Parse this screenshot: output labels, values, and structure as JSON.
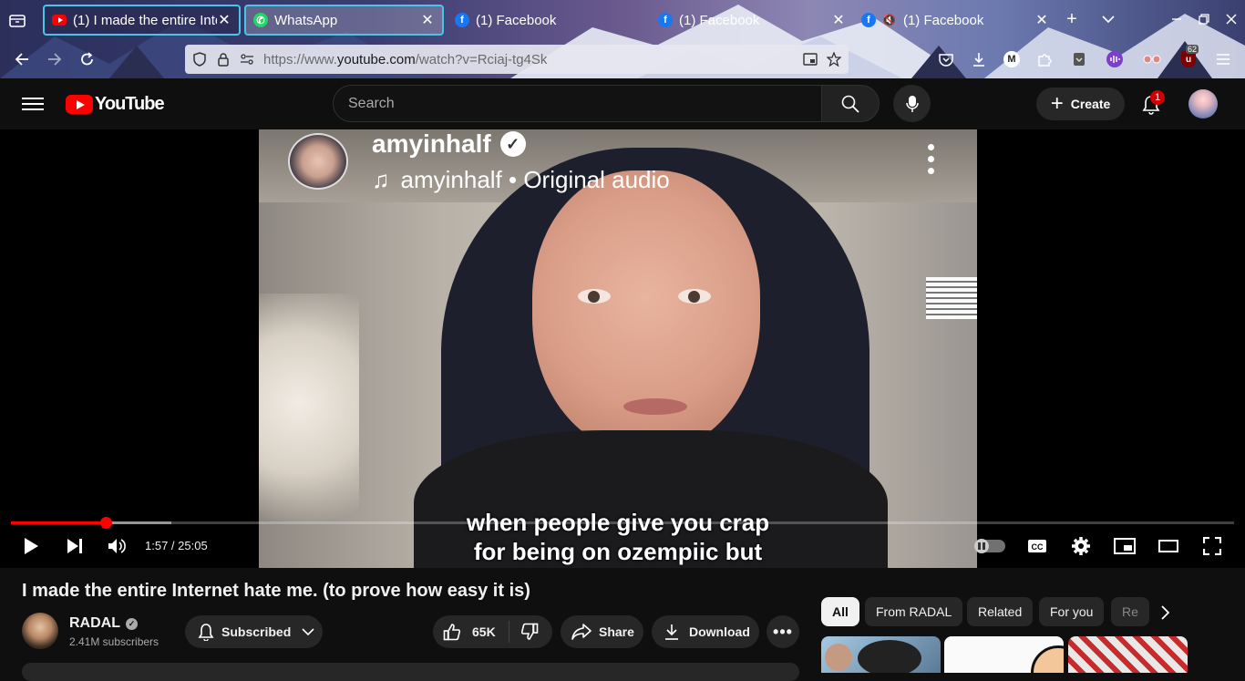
{
  "browser": {
    "tabs": [
      {
        "title": "(1) I made the entire Inte",
        "favicon": "youtube-favicon",
        "active": true
      },
      {
        "title": "WhatsApp",
        "favicon": "whatsapp-favicon",
        "active": false
      },
      {
        "title": "(1) Facebook",
        "favicon": "facebook-favicon",
        "active": false
      },
      {
        "title": "(1) Facebook",
        "favicon": "facebook-favicon",
        "active": false
      },
      {
        "title": "(1) Facebook",
        "favicon": "facebook-favicon",
        "muted": true,
        "active": false
      }
    ],
    "url_prefix": "https://www.",
    "url_domain": "youtube.com",
    "url_rest": "/watch?v=Rciaj-tg4Sk",
    "extension_badge": "62"
  },
  "youtube": {
    "logo_text": "YouTube",
    "search_placeholder": "Search",
    "create_label": "Create",
    "notification_count": "1"
  },
  "player": {
    "overlay_channel": "amyinhalf",
    "overlay_audio": "amyinhalf • Original audio",
    "caption_line1": "when people give you crap",
    "caption_line2": "for being on ozempiic but",
    "current_time": "1:57",
    "duration": "25:05",
    "time_display": "1:57 / 25:05",
    "played_fraction": 0.0778,
    "buffered_fraction": 0.131
  },
  "video": {
    "title": "I made the entire Internet hate me. (to prove how easy it is)",
    "channel": "RADAL",
    "subscribers": "2.41M subscribers",
    "subscribed_label": "Subscribed",
    "likes": "65K",
    "share_label": "Share",
    "download_label": "Download"
  },
  "related": {
    "chips": [
      "All",
      "From RADAL",
      "Related",
      "For you",
      "Re"
    ]
  },
  "colors": {
    "accent_red": "#ff0000",
    "tab_highlight": "#46c6e8",
    "background": "#0f0f0f"
  }
}
